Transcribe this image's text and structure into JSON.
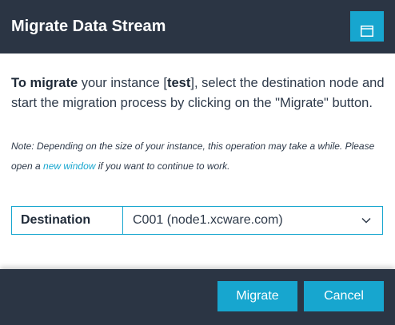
{
  "dialog": {
    "title": "Migrate Data Stream",
    "maximize_icon": "window-maximize-icon"
  },
  "intro": {
    "lead_bold": "To migrate",
    "text_before_instance": " your instance [",
    "instance_name": "test",
    "text_after_instance": "], select the destination node and start the migration process by clicking on the \"Migrate\" button."
  },
  "note": {
    "before_link": "Note: Depending on the size of your instance, this operation may take a while. Please open a ",
    "link_text": "new window",
    "after_link": " if you want to continue to work."
  },
  "destination": {
    "label": "Destination",
    "selected_value": "C001 (node1.xcware.com)",
    "dropdown_icon": "chevron-down-icon"
  },
  "footer": {
    "migrate_label": "Migrate",
    "cancel_label": "Cancel"
  },
  "colors": {
    "header_bg": "#2b3544",
    "accent": "#17a6cf",
    "text": "#2e3a4a"
  }
}
